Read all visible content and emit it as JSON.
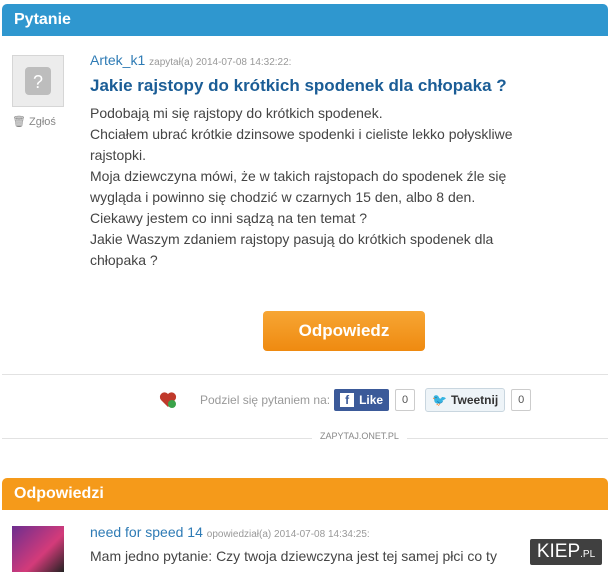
{
  "question_section": {
    "header": "Pytanie"
  },
  "question": {
    "author": "Artek_k1",
    "asked_label": "zapytał(a) 2014-07-08 14:32:22:",
    "title": "Jakie rajstopy do krótkich spodenek dla chłopaka ?",
    "report_label": "Zgłoś",
    "body_lines": [
      "Podobają mi się rajstopy do krótkich spodenek.",
      "Chciałem ubrać krótkie dzinsowe spodenki i cieliste lekko połyskliwe",
      "rajstopki.",
      "Moja dziewczyna mówi, że w takich rajstopach do spodenek źle się",
      "wygląda i powinno się chodzić w czarnych 15 den, albo 8 den.",
      "Ciekawy jestem co inni sądzą na ten temat ?",
      "Jakie Waszym zdaniem rajstopy pasują do krótkich spodenek dla",
      "chłopaka ?"
    ]
  },
  "answer_button": "Odpowiedz",
  "share": {
    "label": "Podziel się pytaniem na:",
    "facebook_letter": "f",
    "facebook_label": "Like",
    "facebook_count": "0",
    "twitter_label": "Tweetnij",
    "twitter_count": "0",
    "icons": {
      "heart": "heart-icon",
      "facebook": "facebook-icon",
      "twitter": "twitter-bird-icon"
    }
  },
  "brand": "ZAPYTAJ.ONET.PL",
  "answers_section": {
    "header": "Odpowiedzi"
  },
  "answer": {
    "author": "need for speed 14",
    "asked_label": "opowiedział(a) 2014-07-08 14:34:25:",
    "text": "Mam jedno pytanie: Czy twoja dziewczyna jest tej samej płci co ty"
  },
  "watermark": {
    "main": "KIEP",
    "suffix": ".PL"
  },
  "colors": {
    "question_header": "#2f97cf",
    "answers_header": "#f59a1a",
    "link": "#1b5d96",
    "button": "#f29218"
  }
}
